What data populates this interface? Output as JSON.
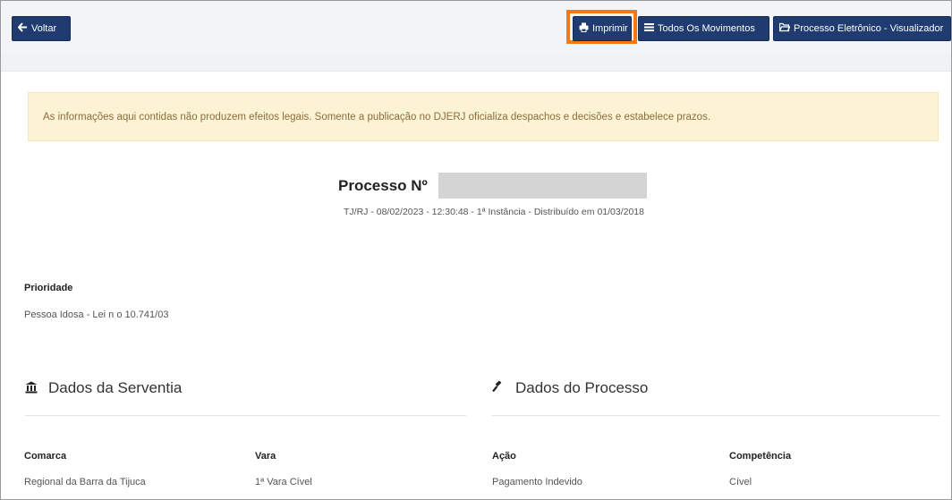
{
  "toolbar": {
    "back_label": "Voltar",
    "print_label": "Imprimir",
    "all_moves_label": "Todos Os Movimentos",
    "eproc_label": "Processo Eletrônico - Visualizador"
  },
  "alert": {
    "text": "As informações aqui contidas não produzem efeitos legais. Somente a publicação no DJERJ oficializa despachos e decisões e estabelece prazos."
  },
  "process": {
    "title": "Processo Nº",
    "subtitle": "TJ/RJ - 08/02/2023 - 12:30:48 - 1ª Instância - Distribuído em 01/03/2018"
  },
  "priority": {
    "label": "Prioridade",
    "value": "Pessoa Idosa - Lei n o 10.741/03"
  },
  "serventia": {
    "heading": "Dados da Serventia",
    "comarca_label": "Comarca",
    "comarca_value": "Regional da Barra da Tijuca",
    "vara_label": "Vara",
    "vara_value": "1ª Vara Cível"
  },
  "dados_processo": {
    "heading": "Dados do Processo",
    "acao_label": "Ação",
    "acao_value": "Pagamento Indevido",
    "competencia_label": "Competência",
    "competencia_value": "Cível"
  }
}
